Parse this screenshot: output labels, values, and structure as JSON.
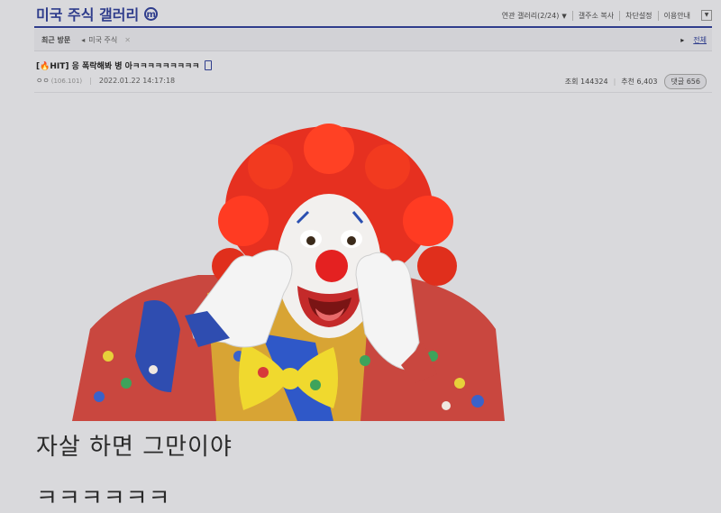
{
  "header": {
    "gallery_name": "미국 주식 갤러리",
    "badge": "m",
    "menu": {
      "minor_gallery": "연관 갤러리(2/24)",
      "copy_address": "갤주소 복사",
      "block_settings": "차단설정",
      "guide": "이용안내"
    }
  },
  "recent_bar": {
    "label": "최근 방문",
    "tab_label": "미국 주식",
    "all_label": "전체"
  },
  "post": {
    "title": "[🔥HIT] 응 폭락해봐 병  아ㅋㅋㅋㅋㅋㅋㅋㅋㅋ",
    "author": "ㅇㅇ",
    "ip": "(106.101)",
    "datetime": "2022.01.22 14:17:18",
    "views_label": "조회 144324",
    "recommend_label": "추천 6,403",
    "comments_label": "댓글 656",
    "body_lines": [
      "자살 하면 그만이야",
      "ㅋㅋㅋㅋㅋㅋ"
    ]
  },
  "colors": {
    "brand": "#2f3d8c",
    "background": "#d9d9dc"
  },
  "icons": {
    "mobile": "mobile-icon",
    "dropdown": "caret-down-icon",
    "arrow_left": "chevron-left-icon",
    "arrow_right": "chevron-right-icon",
    "close": "close-icon",
    "menu": "menu-icon"
  }
}
